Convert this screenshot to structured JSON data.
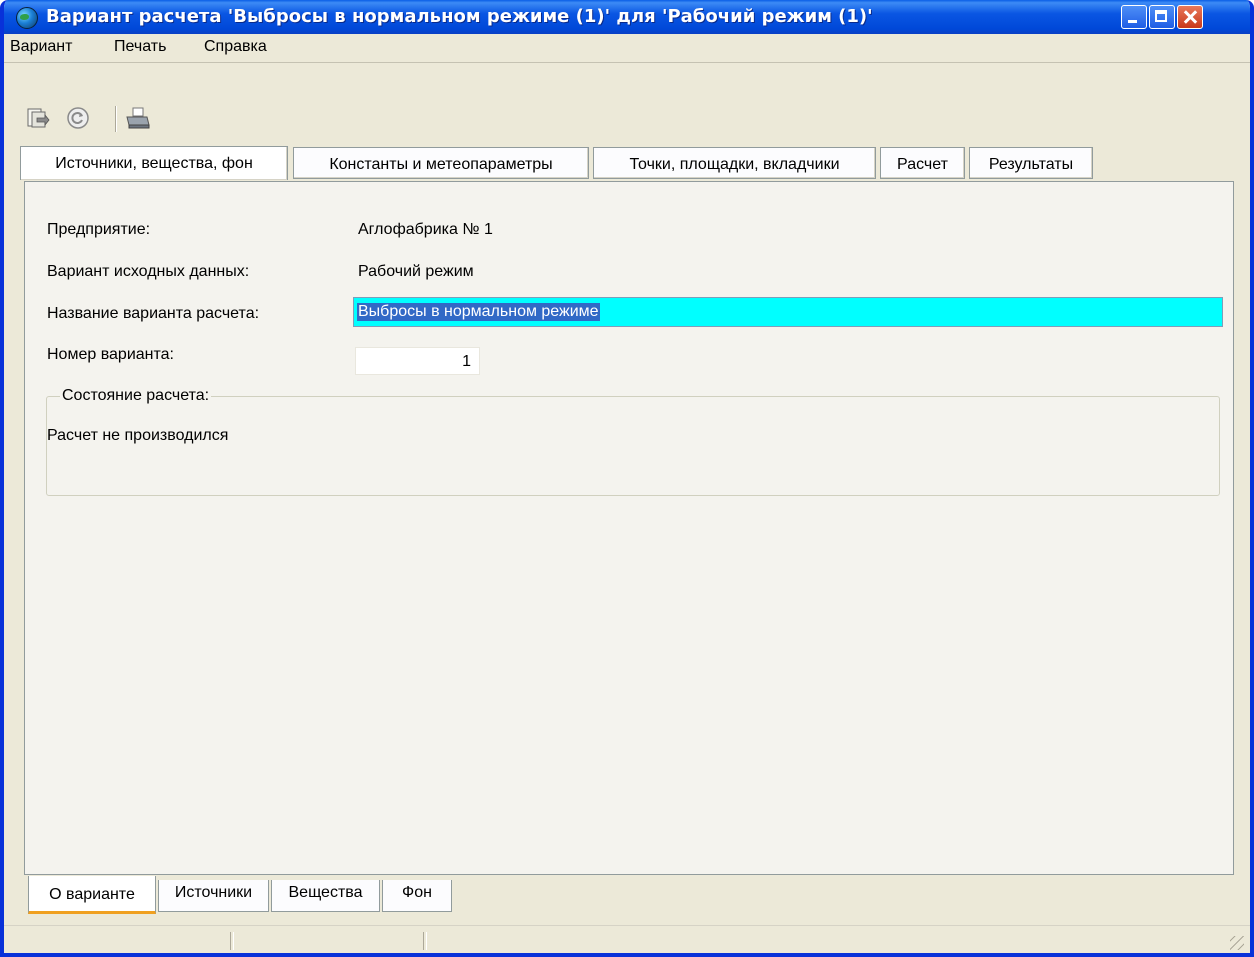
{
  "window": {
    "title": "Вариант расчета 'Выбросы в нормальном режиме (1)' для  'Рабочий режим (1)'"
  },
  "menu": [
    "Вариант",
    "Печать",
    "Справка"
  ],
  "toolbar": {
    "icons": [
      "document-export-icon",
      "refresh-icon",
      "printer-icon"
    ]
  },
  "top_tabs": [
    "Источники, вещества, фон",
    "Константы и метеопараметры",
    "Точки, площадки, вкладчики",
    "Расчет",
    "Результаты"
  ],
  "form": {
    "enterprise_label": "Предприятие:",
    "enterprise_value": "Аглофабрика № 1",
    "source_variant_label": "Вариант исходных данных:",
    "source_variant_value": "Рабочий режим",
    "calc_name_label": "Название варианта расчета:",
    "calc_name_value": "Выбросы в нормальном режиме",
    "variant_number_label": "Номер варианта:",
    "variant_number_value": "1",
    "status_group_label": "Состояние расчета:",
    "status_value": "Расчет не производился"
  },
  "bottom_tabs": [
    "О варианте",
    "Источники",
    "Вещества",
    "Фон"
  ],
  "colors": {
    "title_bar": "#0a56e3",
    "highlight_input": "#00ffff",
    "selection": "#3169c6"
  }
}
